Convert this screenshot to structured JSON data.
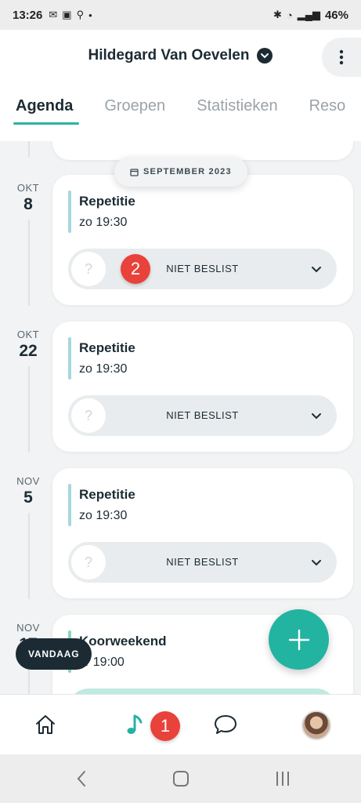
{
  "status_bar": {
    "time": "13:26",
    "battery": "46%"
  },
  "header": {
    "title": "Hildegard Van Oevelen"
  },
  "tabs": [
    {
      "label": "Agenda",
      "active": true
    },
    {
      "label": "Groepen",
      "active": false
    },
    {
      "label": "Statistieken",
      "active": false
    },
    {
      "label": "Reso",
      "active": false
    }
  ],
  "month_pill": "SEPTEMBER 2023",
  "events": [
    {
      "month": "OKT",
      "day": "8",
      "title": "Repetitie",
      "time": "zo 19:30",
      "rsvp_icon": "?",
      "rsvp_label": "NIET BESLIST"
    },
    {
      "month": "OKT",
      "day": "22",
      "title": "Repetitie",
      "time": "zo 19:30",
      "rsvp_icon": "?",
      "rsvp_label": "NIET BESLIST"
    },
    {
      "month": "NOV",
      "day": "5",
      "title": "Repetitie",
      "time": "zo 19:30",
      "rsvp_icon": "?",
      "rsvp_label": "NIET BESLIST"
    },
    {
      "month": "NOV",
      "day": "17",
      "title": "Koorweekend",
      "time": "vr 19:00"
    }
  ],
  "badges": {
    "rsvp_badge": "2",
    "nav_badge": "1"
  },
  "today_button": "VANDAAG",
  "colors": {
    "accent": "#23b3a1",
    "dark": "#1c2b33",
    "badge": "#e8423b"
  },
  "nav": [
    "home-icon",
    "music-note-icon",
    "chat-icon",
    "avatar"
  ]
}
